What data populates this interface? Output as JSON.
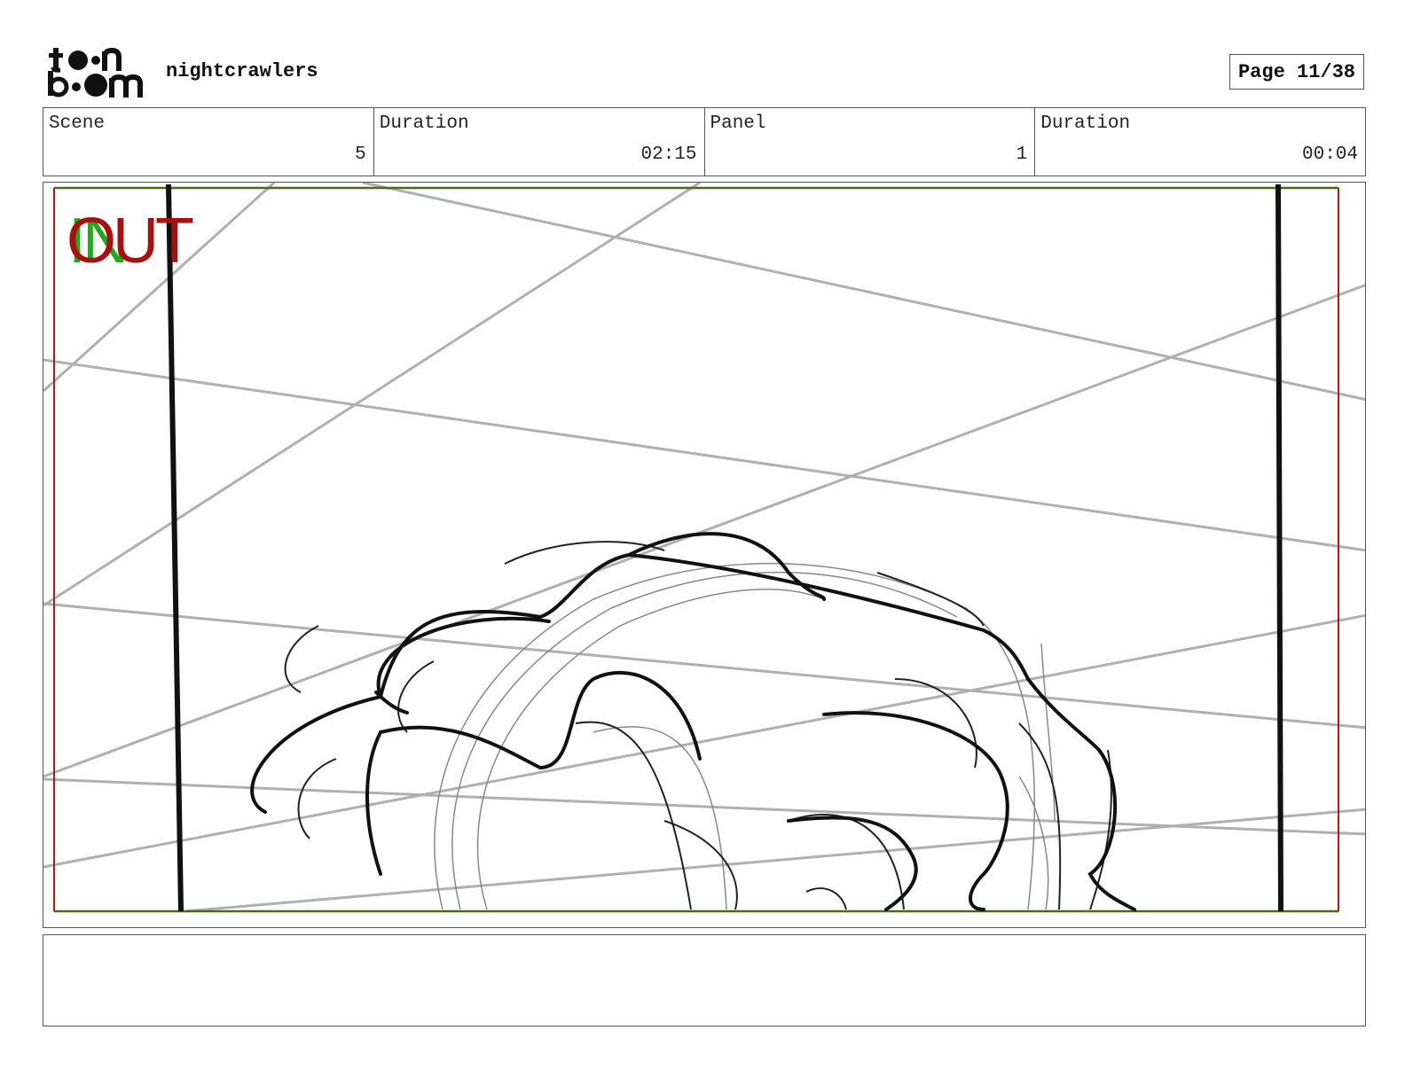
{
  "header": {
    "logo_text": "toon boom",
    "project_name": "nightcrawlers",
    "page_label": "Page 11/38"
  },
  "info": [
    {
      "label": "Scene",
      "value": "5"
    },
    {
      "label": "Duration",
      "value": "02:15"
    },
    {
      "label": "Panel",
      "value": "1"
    },
    {
      "label": "Duration",
      "value": "00:04"
    }
  ],
  "panel": {
    "in_marker": "IN",
    "out_marker": "OUT",
    "colors": {
      "in": "#1faa1f",
      "out": "#a80f0f",
      "frame_top": "#4a6a1a",
      "frame_sides": "#b01818",
      "guide_lines": "#b0b0b0",
      "sketch": "#111111"
    }
  },
  "notes": {
    "text": ""
  }
}
